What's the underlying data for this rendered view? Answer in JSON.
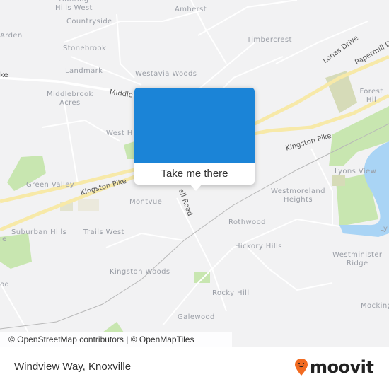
{
  "map": {
    "place_labels": [
      {
        "id": "hunting-hills-west",
        "text": "Hunting\nHills West"
      },
      {
        "id": "amherst",
        "text": "Amherst"
      },
      {
        "id": "countryside",
        "text": "Countryside"
      },
      {
        "id": "arden",
        "text": "Arden"
      },
      {
        "id": "timbercrest",
        "text": "Timbercrest"
      },
      {
        "id": "stonebrook",
        "text": "Stonebrook"
      },
      {
        "id": "landmark",
        "text": "Landmark"
      },
      {
        "id": "westavia-woods",
        "text": "Westavia Woods"
      },
      {
        "id": "middlebrook-acres",
        "text": "Middlebrook\nAcres"
      },
      {
        "id": "forest-hills",
        "text": "Forest Hil"
      },
      {
        "id": "west-hills",
        "text": "West H"
      },
      {
        "id": "green-valley",
        "text": "Green Valley"
      },
      {
        "id": "montvue",
        "text": "Montvue"
      },
      {
        "id": "lyons-view",
        "text": "Lyons View"
      },
      {
        "id": "westmoreland-heights",
        "text": "Westmoreland\nHeights"
      },
      {
        "id": "suburban-hills",
        "text": "Suburban Hills"
      },
      {
        "id": "trails-west",
        "text": "Trails West"
      },
      {
        "id": "rothwood",
        "text": "Rothwood"
      },
      {
        "id": "hickory-hills",
        "text": "Hickory Hills"
      },
      {
        "id": "westminister-ridge",
        "text": "Westminister\nRidge"
      },
      {
        "id": "kingston-woods",
        "text": "Kingston Woods"
      },
      {
        "id": "rocky-hill",
        "text": "Rocky Hill"
      },
      {
        "id": "mockingbird",
        "text": "Mocking"
      },
      {
        "id": "galewood",
        "text": "Galewood"
      },
      {
        "id": "lyons-edge",
        "text": "Ly"
      },
      {
        "id": "edge-ville",
        "text": "le"
      },
      {
        "id": "edge-wood",
        "text": "od"
      }
    ],
    "road_labels": {
      "middlebrook_pike": "Middle",
      "kingston_pike_west": "Kingston Pike",
      "kingston_pike_east": "Kingston Pike",
      "lonas_drive": "Lonas Drive",
      "papermill_drive": "Papermill D",
      "road_north": "ell Road",
      "pike_edge": "ke"
    },
    "attribution": "© OpenStreetMap contributors | © OpenMapTiles"
  },
  "popup": {
    "button_label": "Take me there",
    "image_color": "#1b84d7"
  },
  "footer": {
    "location_title": "Windview Way, Knoxville",
    "brand": "moovit",
    "brand_color": "#f26b21"
  }
}
